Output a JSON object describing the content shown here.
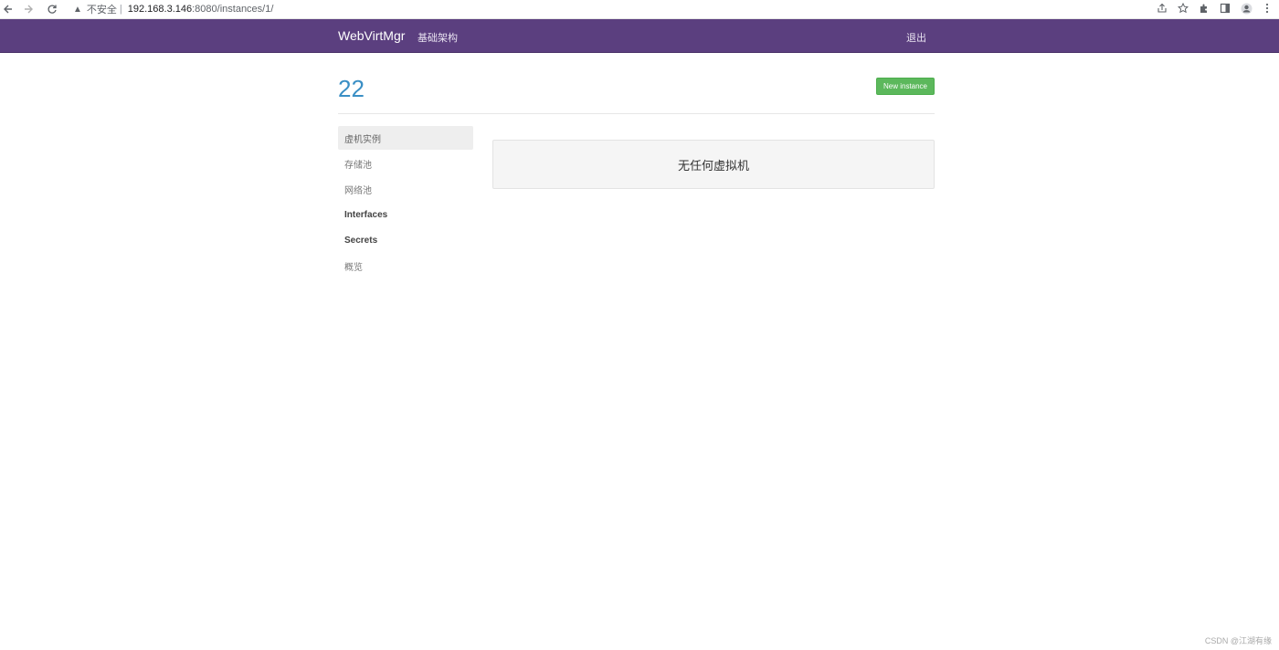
{
  "browser": {
    "insecure_label": "不安全",
    "separator": "|",
    "url_host": "192.168.3.146",
    "url_path": ":8080/instances/1/"
  },
  "navbar": {
    "brand": "WebVirtMgr",
    "infrastructure_link": "基础架构",
    "logout_link": "退出",
    "background_color": "#5b3f7f"
  },
  "header": {
    "title": "22",
    "new_instance_button": "New instance"
  },
  "sidebar": {
    "items": [
      {
        "label": "虚机实例"
      },
      {
        "label": "存储池"
      },
      {
        "label": "网络池"
      },
      {
        "label": "Interfaces"
      },
      {
        "label": "Secrets"
      },
      {
        "label": "概览"
      }
    ]
  },
  "main": {
    "empty_message": "无任何虚拟机"
  },
  "watermark": "CSDN @江湖有缘",
  "colors": {
    "title": "#3a8fc5",
    "success_button": "#5cb85c"
  }
}
